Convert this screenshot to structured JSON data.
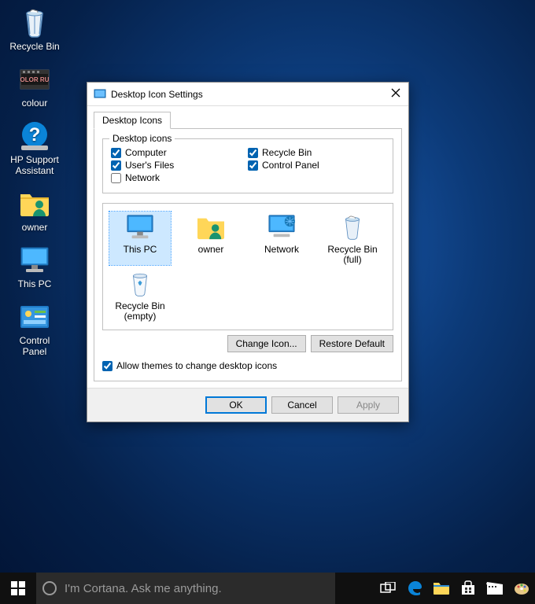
{
  "desktop": {
    "icons": [
      {
        "label": "Recycle Bin",
        "icon": "recycle-bin-full"
      },
      {
        "label": "colour",
        "icon": "video-file"
      },
      {
        "label": "HP Support Assistant",
        "icon": "help-question"
      },
      {
        "label": "owner",
        "icon": "user-folder"
      },
      {
        "label": "This PC",
        "icon": "computer"
      },
      {
        "label": "Control Panel",
        "icon": "control-panel"
      }
    ]
  },
  "dialog": {
    "title": "Desktop Icon Settings",
    "tab": "Desktop Icons",
    "group_legend": "Desktop icons",
    "checks_left": [
      {
        "label": "Computer",
        "checked": true
      },
      {
        "label": "User's Files",
        "checked": true
      },
      {
        "label": "Network",
        "checked": false
      }
    ],
    "checks_right": [
      {
        "label": "Recycle Bin",
        "checked": true
      },
      {
        "label": "Control Panel",
        "checked": true
      }
    ],
    "preview_icons": [
      {
        "label": "This PC",
        "icon": "computer",
        "selected": true
      },
      {
        "label": "owner",
        "icon": "user-folder"
      },
      {
        "label": "Network",
        "icon": "network"
      },
      {
        "label": "Recycle Bin (full)",
        "icon": "recycle-bin-full"
      },
      {
        "label": "Recycle Bin (empty)",
        "icon": "recycle-bin-empty"
      }
    ],
    "btn_change": "Change Icon...",
    "btn_restore": "Restore Default",
    "allow_label": "Allow themes to change desktop icons",
    "allow_checked": true,
    "btn_ok": "OK",
    "btn_cancel": "Cancel",
    "btn_apply": "Apply"
  },
  "taskbar": {
    "cortana_placeholder": "I'm Cortana. Ask me anything.",
    "items": [
      "task-view",
      "edge",
      "file-explorer",
      "store",
      "movies",
      "paint"
    ]
  }
}
